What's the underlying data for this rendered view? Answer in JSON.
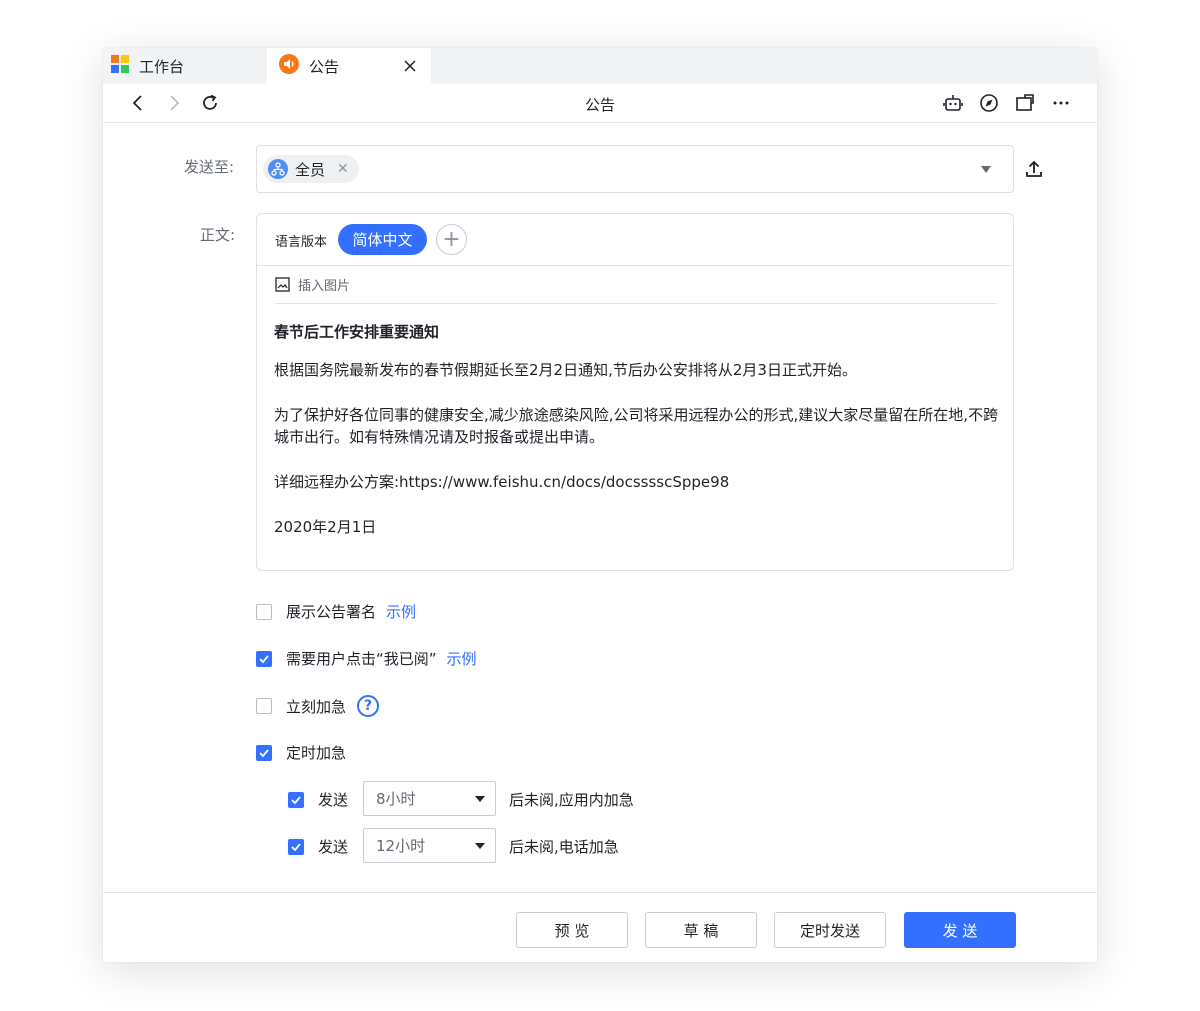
{
  "tabs": [
    {
      "label": "工作台"
    },
    {
      "label": "公告"
    }
  ],
  "toolbar": {
    "title": "公告"
  },
  "form": {
    "send_to_label": "发送至:",
    "recipient_chip": "全员",
    "body_label": "正文:",
    "language_label": "语言版本",
    "language_selected": "简体中文",
    "insert_image": "插入图片",
    "content": {
      "title": "春节后工作安排重要通知",
      "p1": "根据国务院最新发布的春节假期延长至2月2日通知,节后办公安排将从2月3日正式开始。",
      "p2": "为了保护好各位同事的健康安全,减少旅途感染风险,公司将采用远程办公的形式,建议大家尽量留在所在地,不跨城市出行。如有特殊情况请及时报备或提出申请。",
      "p3": "详细远程办公方案:https://www.feishu.cn/docs/docsssscSppe98",
      "p4": "2020年2月1日"
    }
  },
  "options": {
    "show_signature": {
      "label": "展示公告署名",
      "checked": false,
      "example": "示例"
    },
    "require_read": {
      "label": "需要用户点击“我已阅”",
      "checked": true,
      "example": "示例"
    },
    "urgent_now": {
      "label": "立刻加急",
      "checked": false,
      "help": "?"
    },
    "scheduled_urgent": {
      "label": "定时加急",
      "checked": true
    },
    "rule1": {
      "checked": true,
      "send": "发送",
      "value": "8小时",
      "suffix": "后未阅,应用内加急"
    },
    "rule2": {
      "checked": true,
      "send": "发送",
      "value": "12小时",
      "suffix": "后未阅,电话加急"
    }
  },
  "footer": {
    "preview": "预 览",
    "draft": "草 稿",
    "scheduled_send": "定时发送",
    "send": "发 送"
  },
  "colors": {
    "accent": "#3370ff",
    "tab_icon_orange": "#f5771b"
  }
}
